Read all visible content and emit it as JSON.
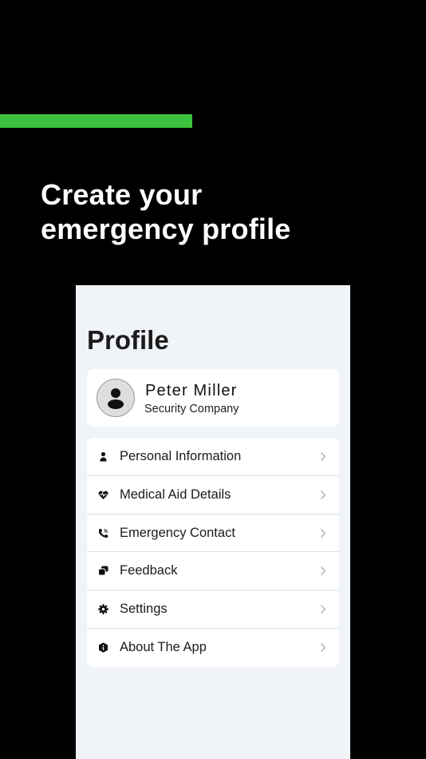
{
  "headline": {
    "line1": "Create your",
    "line2": "emergency profile"
  },
  "colors": {
    "accent": "#3cc23c",
    "background": "#000000",
    "panel": "#f0f3f7"
  },
  "profile": {
    "title": "Profile",
    "user": {
      "name": "Peter Miller",
      "company": "Security Company"
    }
  },
  "menu": {
    "items": [
      {
        "label": "Personal Information",
        "icon": "person-icon"
      },
      {
        "label": "Medical Aid Details",
        "icon": "heart-pulse-icon"
      },
      {
        "label": "Emergency Contact",
        "icon": "phone-call-icon"
      },
      {
        "label": "Feedback",
        "icon": "chat-bubbles-icon"
      },
      {
        "label": "Settings",
        "icon": "gear-icon"
      },
      {
        "label": "About The App",
        "icon": "info-shield-icon"
      }
    ]
  }
}
